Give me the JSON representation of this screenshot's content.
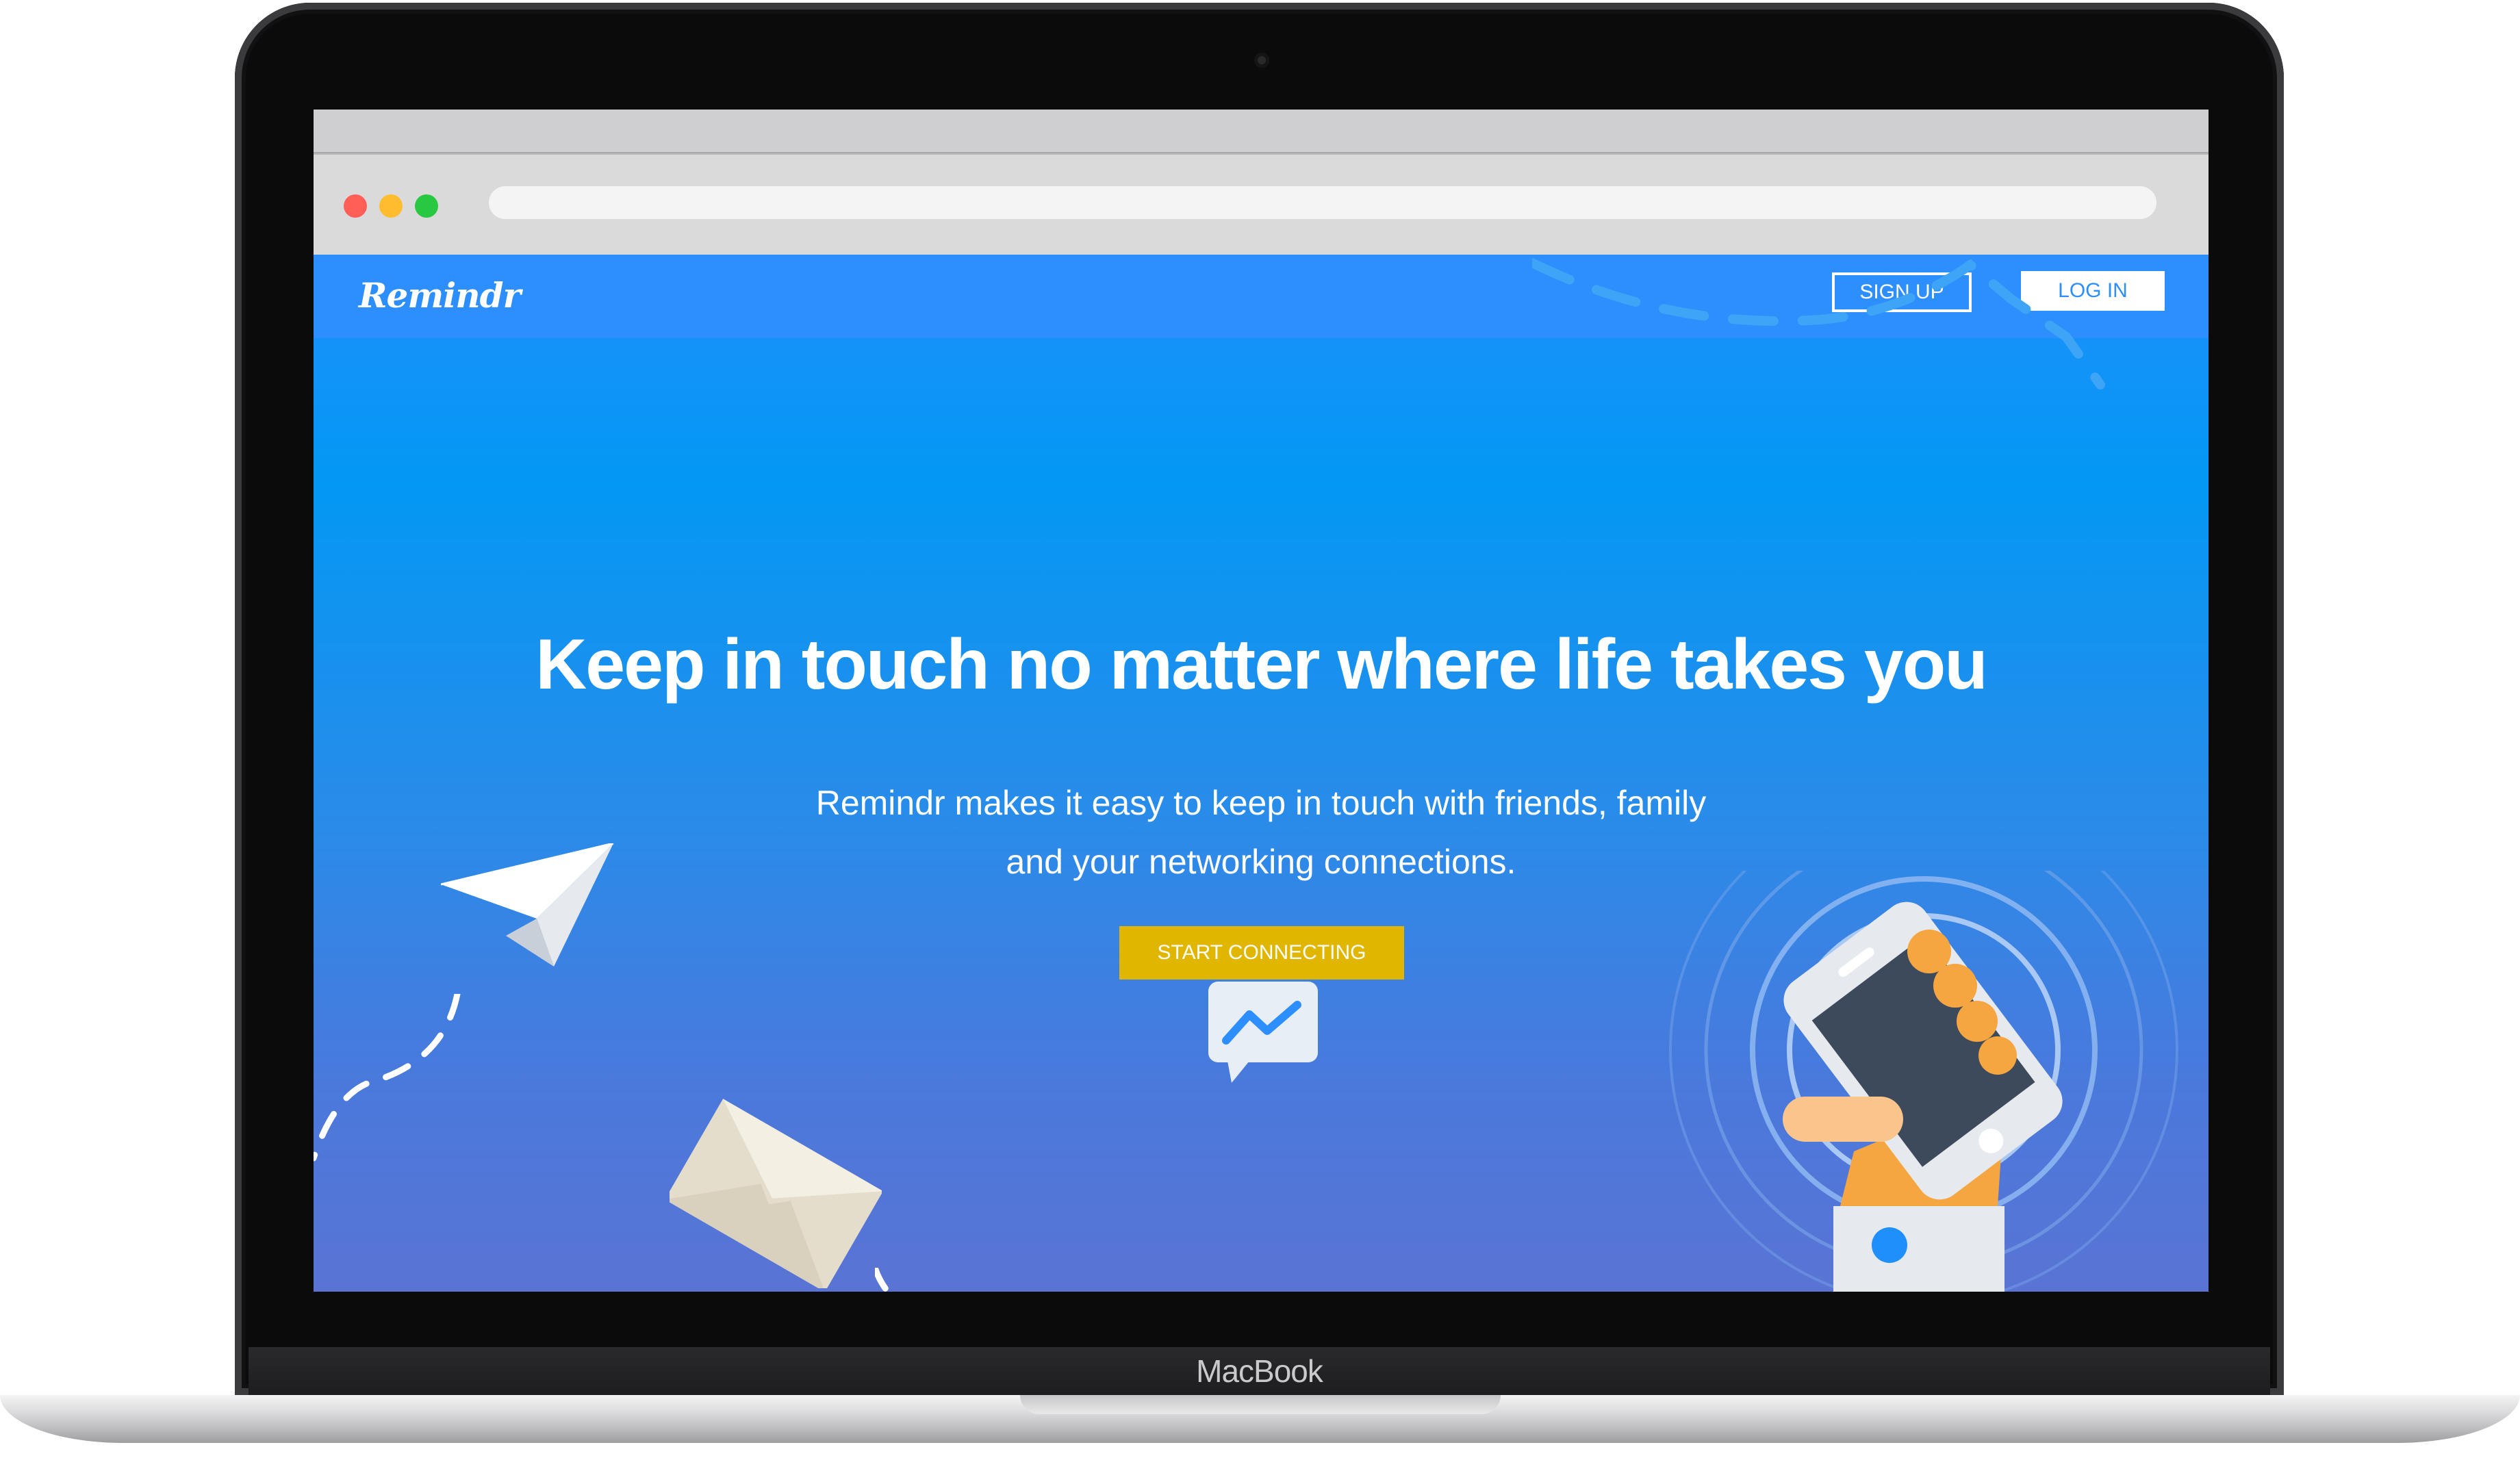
{
  "device": {
    "brand_label": "MacBook"
  },
  "browser": {
    "traffic_lights": [
      "close",
      "minimize",
      "maximize"
    ],
    "address": ""
  },
  "site": {
    "logo": "Remindr",
    "nav": {
      "signup": "SIGN UP",
      "login": "LOG IN"
    },
    "hero": {
      "headline": "Keep in touch no matter where life takes you",
      "subhead_line1": "Remindr makes it easy to keep in touch with friends, family",
      "subhead_line2": "and your networking connections.",
      "cta": "START CONNECTING"
    }
  },
  "icons": [
    "paper-plane-icon",
    "envelope-icon",
    "messenger-icon",
    "phone-in-hand-icon"
  ],
  "colors": {
    "nav_bg": "#2d8ffd",
    "cta_bg": "#e0b600",
    "gradient_top": "#0398f4",
    "gradient_bottom": "#5974d4",
    "phone_screen": "#3d4a5c",
    "hand": "#f5a640"
  }
}
